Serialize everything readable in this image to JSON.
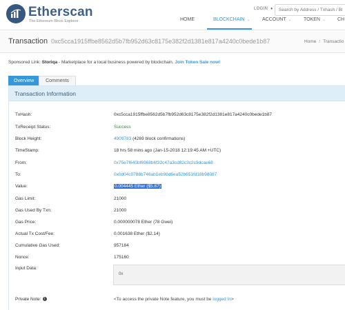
{
  "header": {
    "logo_title": "Etherscan",
    "logo_subtitle": "The Ethereum Block Explorer",
    "login_label": "LOGIN  ♦",
    "search_placeholder": "Search by Address / Txhash / Bl",
    "nav": [
      {
        "label": "HOME"
      },
      {
        "label": "BLOCKCHAIN",
        "dropdown": true
      },
      {
        "label": "ACCOUNT",
        "dropdown": true
      },
      {
        "label": "TOKEN",
        "dropdown": true
      },
      {
        "label": "CH"
      }
    ],
    "active_nav": "BLOCKCHAIN"
  },
  "title": {
    "label": "Transaction",
    "hash": "0xc5cca1915ffbe8562d5b7fb952d63c8175e382f2d1381e817a4240c0bede1b87"
  },
  "breadcrumb": [
    "Home",
    "Transactio"
  ],
  "sponsored": {
    "prefix": "Sponsored Link:",
    "name": "Storiqa",
    "text": " - Marketplace for a local business powered by blockchain. ",
    "cta": "Join Token Sale now!"
  },
  "tabs": [
    {
      "label": "Overview",
      "active": true
    },
    {
      "label": "Comments",
      "active": false
    }
  ],
  "panel_title": "Transaction Information",
  "fields": {
    "txhash": {
      "label": "TxHash:",
      "value": "0xc5cca1915ffbe8562d5b7fb952d63c8175e382f2d1381e817a4240c0bede1b87"
    },
    "receipt": {
      "label": "TxReceipt Status:",
      "value": "Success"
    },
    "block": {
      "label": "Block Height:",
      "value": "4909783",
      "extra": " (4269 block confirmations)"
    },
    "timestamp": {
      "label": "TimeStamp:",
      "value": "18 hrs 58 mins ago (Jan-15-2018 12:19:45 AM +UTC)"
    },
    "from": {
      "label": "From:",
      "value": "0x75e7f640bf6968b6f32c47a3cd82c3c2c9dcae68"
    },
    "to": {
      "label": "To:",
      "value": "0x0d04c0788b746ab1eb98d6ea52b651fd18b98087"
    },
    "value": {
      "label": "Value:",
      "value": "0.004445 Ether ($5.87)"
    },
    "gas_limit": {
      "label": "Gas Limit:",
      "value": "21000"
    },
    "gas_used": {
      "label": "Gas Used By Txn:",
      "value": "21000"
    },
    "gas_price": {
      "label": "Gas Price:",
      "value": "0.000000078 Ether (78 Gwei)"
    },
    "tx_fee": {
      "label": "Actual Tx Cost/Fee:",
      "value": "0.001638 Ether ($2.14)"
    },
    "cumulative": {
      "label": "Cumulative Gas Used:",
      "value": "957184"
    },
    "nonce": {
      "label": "Nonce:",
      "value": "175160"
    },
    "input": {
      "label": "Input Data:",
      "value": "0x"
    },
    "private_note": {
      "label": "Private Note:",
      "prefix": "<To access the private Note feature, you must be ",
      "link": "logged In",
      "suffix": ">"
    }
  },
  "colors": {
    "brand": "#3f5f8a",
    "link": "#3498db",
    "success": "#2a8b3a",
    "panel_header": "#ddeef8"
  }
}
